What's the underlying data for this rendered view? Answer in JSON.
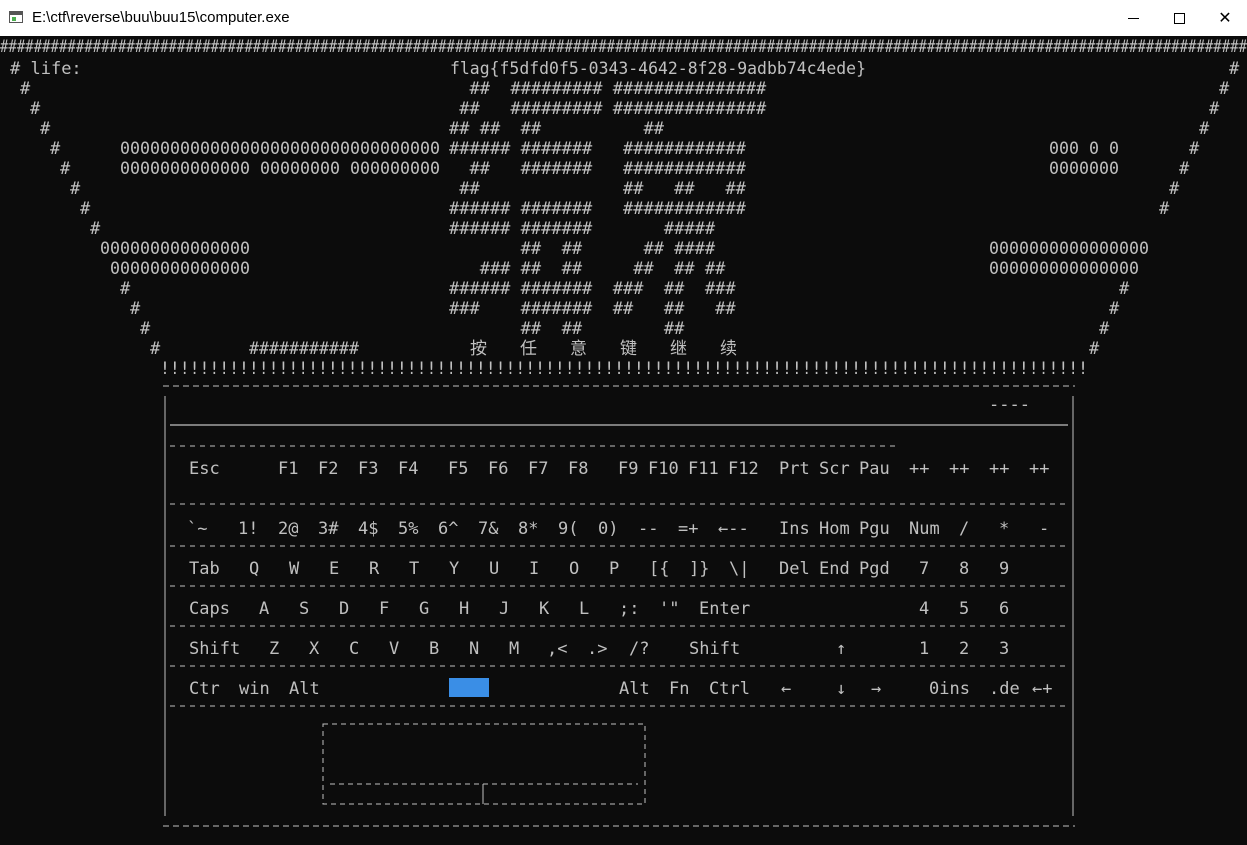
{
  "window": {
    "title": "E:\\ctf\\reverse\\buu\\buu15\\computer.exe",
    "icon": "console-app-icon",
    "controls": [
      "minimize-icon",
      "maximize-icon",
      "close-icon"
    ]
  },
  "console": {
    "text_color": "#c0c0c0",
    "background": "#0c0c0c",
    "highlight_color": "#3a8ee6",
    "life_label": "life:",
    "flag": "flag{f5dfd0f5-0343-4642-8f28-9adbb74c4ede}",
    "prompt_chars": [
      "按",
      "任",
      "意",
      "键",
      "继",
      "续"
    ],
    "top_border": "####################################################################################################################################################",
    "bang_row": "!!!!!!!!!!!!!!!!!!!!!!!!!!!!!!!!!!!!!!!!!!!!!!!!!!!!!!!!!!!!!!!!!!!!!!!!!!!!!!!!!!!!!!!!!!!!!!",
    "health_bar": "###########",
    "center_art": [
      "  ##  ######### ###############",
      " ##   ######### ###############",
      "## ##  ##          ##",
      "###### #######   ############",
      "  ##   #######   ############",
      " ##              ##   ##   ##",
      "###### #######   ############",
      "###### #######       #####",
      "       ##  ##      ## ####",
      "   ### ##  ##     ##  ## ##",
      "###### #######  ###  ##  ###",
      "###    #######  ##   ##   ##",
      "       ##  ##        ##"
    ],
    "left_blocks": [
      "00000000000000000000000000000000",
      "0000000000000 00000000 000000000",
      "000000000000000",
      "00000000000000"
    ],
    "right_blocks": [
      "000 0 0",
      "0000000",
      "0000000000000000",
      "000000000000000"
    ],
    "screen_mark": "----",
    "keyboard_rows": [
      [
        "Esc",
        "F1",
        "F2",
        "F3",
        "F4",
        "F5",
        "F6",
        "F7",
        "F8",
        "F9",
        "F10",
        "F11",
        "F12",
        "Prt",
        "Scr",
        "Pau",
        "++",
        "++",
        "++",
        "++"
      ],
      [
        "`~",
        "1!",
        "2@",
        "3#",
        "4$",
        "5%",
        "6^",
        "7&",
        "8*",
        "9(",
        "0)",
        "--",
        "=+",
        "←--",
        "Ins",
        "Hom",
        "Pgu",
        "Num",
        "/",
        "*",
        "-"
      ],
      [
        "Tab",
        "Q",
        "W",
        "E",
        "R",
        "T",
        "Y",
        "U",
        "I",
        "O",
        "P",
        "[{",
        "]}",
        "\\|",
        "Del",
        "End",
        "Pgd",
        "7",
        "8",
        "9"
      ],
      [
        "Caps",
        "A",
        "S",
        "D",
        "F",
        "G",
        "H",
        "J",
        "K",
        "L",
        ";:",
        "'\"",
        "Enter",
        "4",
        "5",
        "6"
      ],
      [
        "Shift",
        "Z",
        "X",
        "C",
        "V",
        "B",
        "N",
        "M",
        ",<",
        ".>",
        "/?",
        "Shift",
        "↑",
        "1",
        "2",
        "3"
      ],
      [
        "Ctr",
        "win",
        "Alt",
        "Alt",
        "Fn",
        "Ctrl",
        "←",
        "↓",
        "→",
        "0ins",
        ".de",
        "←+"
      ]
    ],
    "key_icons": {
      "up": "arrow-up-icon",
      "down": "arrow-down-icon",
      "left": "arrow-left-icon",
      "right": "arrow-right-icon",
      "backspace": "backspace-icon",
      "enter": "enter-icon"
    }
  }
}
